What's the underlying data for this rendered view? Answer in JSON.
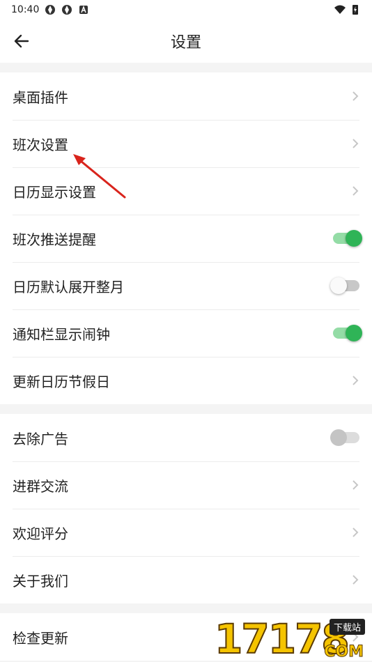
{
  "status": {
    "time": "10:40"
  },
  "header": {
    "title": "设置"
  },
  "groups": [
    {
      "items": [
        {
          "label": "桌面插件",
          "control": "chevron"
        },
        {
          "label": "班次设置",
          "control": "chevron"
        },
        {
          "label": "日历显示设置",
          "control": "chevron"
        },
        {
          "label": "班次推送提醒",
          "control": "toggle",
          "state": "on"
        },
        {
          "label": "日历默认展开整月",
          "control": "toggle",
          "state": "off"
        },
        {
          "label": "通知栏显示闹钟",
          "control": "toggle",
          "state": "on"
        },
        {
          "label": "更新日历节假日",
          "control": "chevron"
        }
      ]
    },
    {
      "items": [
        {
          "label": "去除广告",
          "control": "toggle",
          "state": "off-disabled"
        },
        {
          "label": "进群交流",
          "control": "chevron"
        },
        {
          "label": "欢迎评分",
          "control": "chevron"
        },
        {
          "label": "关于我们",
          "control": "chevron"
        }
      ]
    },
    {
      "items": [
        {
          "label": "检查更新",
          "control": "chevron"
        }
      ]
    }
  ],
  "watermark": {
    "digits": "17178",
    "tag": "下载站",
    "suffix": "COM"
  },
  "colors": {
    "toggle_on": "#2fb457",
    "toggle_on_track": "#94dca6",
    "annotation_arrow": "#d9241c"
  }
}
